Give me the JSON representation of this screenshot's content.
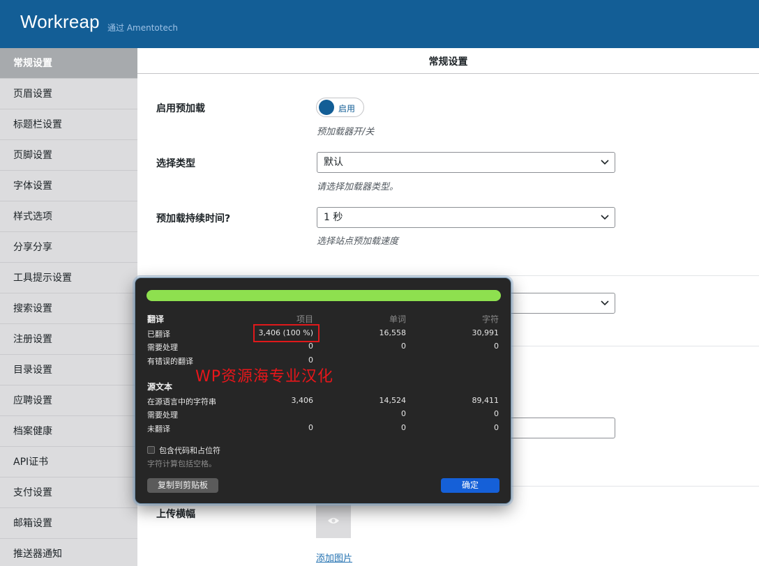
{
  "header": {
    "brand": "Workreap",
    "brand_sub": "通过 Amentotech"
  },
  "sidebar": {
    "items": [
      {
        "label": "常规设置",
        "active": true
      },
      {
        "label": "页眉设置"
      },
      {
        "label": "标题栏设置"
      },
      {
        "label": "页脚设置"
      },
      {
        "label": "字体设置"
      },
      {
        "label": "样式选项"
      },
      {
        "label": "分享分享"
      },
      {
        "label": "工具提示设置"
      },
      {
        "label": "搜索设置"
      },
      {
        "label": "注册设置"
      },
      {
        "label": "目录设置"
      },
      {
        "label": "应聘设置"
      },
      {
        "label": "档案健康"
      },
      {
        "label": "API证书"
      },
      {
        "label": "支付设置"
      },
      {
        "label": "邮箱设置"
      },
      {
        "label": "推送器通知"
      }
    ]
  },
  "main": {
    "title": "常规设置",
    "preloader": {
      "label": "启用预加载",
      "toggle_text": "启用",
      "hint": "预加载器开/关"
    },
    "type": {
      "label": "选择类型",
      "value": "默认",
      "hint": "请选择加载器类型。"
    },
    "duration": {
      "label": "预加载持续时间?",
      "value": "1 秒",
      "hint": "选择站点预加载速度"
    },
    "banner": {
      "label": "上传横幅",
      "add_image": "添加图片"
    }
  },
  "dialog": {
    "translation_heading": "翻译",
    "col_items": "项目",
    "col_words": "单词",
    "col_chars": "字符",
    "translated": {
      "label": "已翻译",
      "items": "3,406 (100 %)",
      "words": "16,558",
      "chars": "30,991"
    },
    "needs_work": {
      "label": "需要处理",
      "items": "0",
      "words": "0",
      "chars": "0"
    },
    "with_errors": {
      "label": "有错误的翻译",
      "items": "0"
    },
    "watermark": "WP资源海专业汉化",
    "source_heading": "源文本",
    "source_strings": {
      "label": "在源语言中的字符串",
      "items": "3,406",
      "words": "14,524",
      "chars": "89,411"
    },
    "source_needs_work": {
      "label": "需要处理",
      "words": "0",
      "chars": "0"
    },
    "untranslated": {
      "label": "未翻译",
      "items": "0",
      "words": "0",
      "chars": "0"
    },
    "include_code_label": "包含代码和占位符",
    "note": "字符计算包括空格。",
    "copy_button": "复制到剪贴板",
    "ok_button": "确定",
    "progress_fraction": 1.0
  },
  "colors": {
    "header_bg": "#135e96",
    "progress": "#8ee04f",
    "ok_button": "#1560d8",
    "highlight": "#e0191b"
  }
}
